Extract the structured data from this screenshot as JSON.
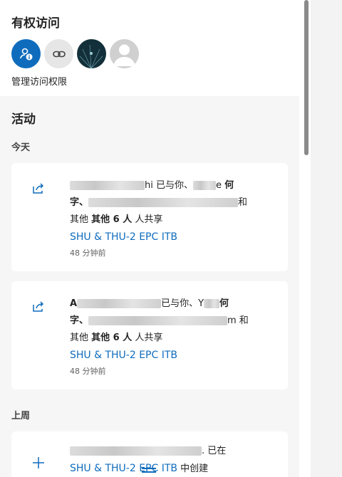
{
  "access": {
    "title": "有权访问",
    "manage_label": "管理访问权限"
  },
  "activity": {
    "title": "活动",
    "groups": [
      {
        "label": "今天",
        "items": [
          {
            "icon": "share-icon",
            "line1_end": "hi 已与你、",
            "line1_tail_a": "e ",
            "line1_tail_b": "何",
            "line2_start": "字、",
            "line2_end": "和",
            "line3_a": "其他 ",
            "line3_b": "其他 6 人",
            "line3_c": " 人共享",
            "project": "SHU & THU-2 EPC ITB",
            "time": "48 分钟前"
          },
          {
            "icon": "share-icon",
            "line1_start": "A",
            "line1_end": "已与你、Y",
            "line1_tail_b": "何",
            "line2_start": "字、",
            "line2_end": "m 和",
            "line3_a": "其他 ",
            "line3_b": "其他 6 人",
            "line3_c": " 人共享",
            "project": "SHU & THU-2 EPC ITB",
            "time": "48 分钟前"
          }
        ]
      },
      {
        "label": "上周",
        "items": [
          {
            "icon": "plus-icon",
            "line1_end": ". 已在",
            "project": "SHU & THU-2 EPC ITB",
            "suffix": " 中创建"
          }
        ]
      }
    ]
  },
  "colors": {
    "accent": "#0f6cbd",
    "activity_bg": "#f6f6f6",
    "card_bg": "#ffffff"
  }
}
